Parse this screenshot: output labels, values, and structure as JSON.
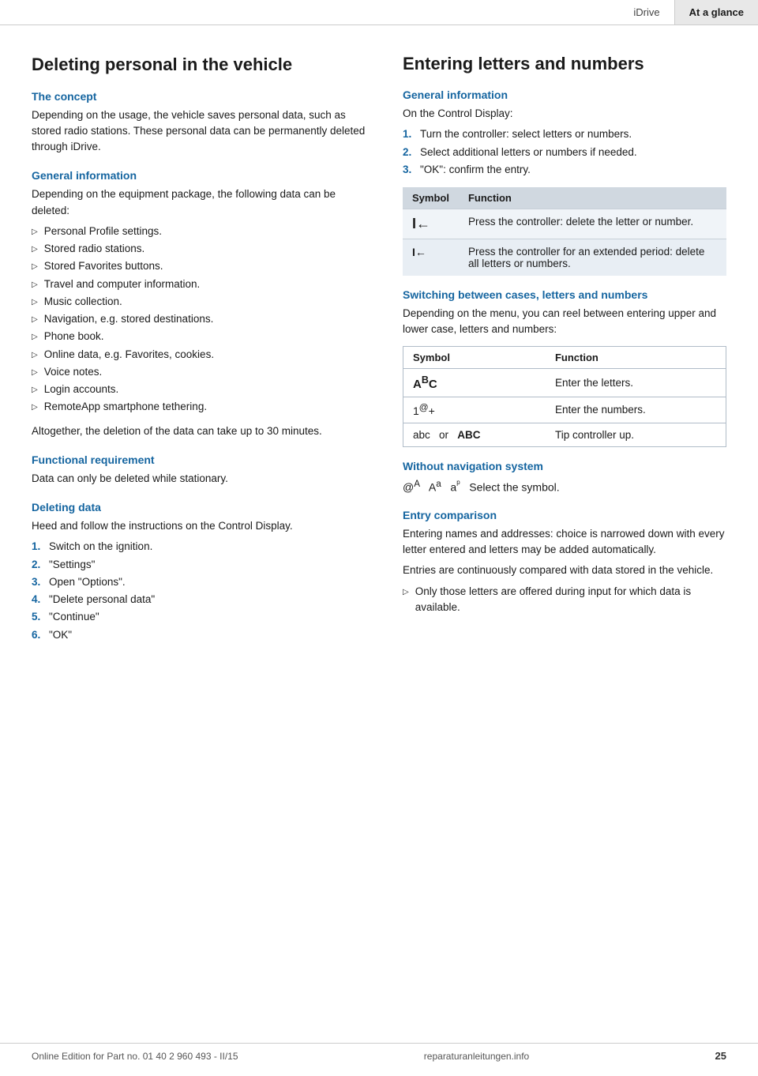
{
  "header": {
    "idrive_label": "iDrive",
    "ataglance_label": "At a glance"
  },
  "left": {
    "page_title": "Deleting personal in the vehicle",
    "sections": [
      {
        "id": "concept",
        "heading": "The concept",
        "paragraphs": [
          "Depending on the usage, the vehicle saves personal data, such as stored radio stations. These personal data can be permanently deleted through iDrive."
        ]
      },
      {
        "id": "general-info",
        "heading": "General information",
        "paragraphs": [
          "Depending on the equipment package, the following data can be deleted:"
        ],
        "bullets": [
          "Personal Profile settings.",
          "Stored radio stations.",
          "Stored Favorites buttons.",
          "Travel and computer information.",
          "Music collection.",
          "Navigation, e.g. stored destinations.",
          "Phone book.",
          "Online data, e.g. Favorites, cookies.",
          "Voice notes.",
          "Login accounts.",
          "RemoteApp smartphone tethering."
        ],
        "after_bullets": "Altogether, the deletion of the data can take up to 30 minutes."
      },
      {
        "id": "functional-req",
        "heading": "Functional requirement",
        "paragraphs": [
          "Data can only be deleted while stationary."
        ]
      },
      {
        "id": "deleting-data",
        "heading": "Deleting data",
        "paragraphs": [
          "Heed and follow the instructions on the Control Display."
        ],
        "steps": [
          "Switch on the ignition.",
          "\"Settings\"",
          "Open \"Options\".",
          "\"Delete personal data\"",
          "\"Continue\"",
          "\"OK\""
        ]
      }
    ]
  },
  "right": {
    "page_title": "Entering letters and numbers",
    "sections": [
      {
        "id": "general-info-right",
        "heading": "General information",
        "paragraphs": [
          "On the Control Display:"
        ],
        "steps": [
          "Turn the controller: select letters or numbers.",
          "Select additional letters or numbers if needed.",
          "\"OK\": confirm the entry."
        ],
        "table": {
          "headers": [
            "Symbol",
            "Function"
          ],
          "rows": [
            {
              "symbol": "I←",
              "function": "Press the controller: delete the letter or number."
            },
            {
              "symbol": "I←",
              "function": "Press the controller for an extended period: delete all letters or numbers."
            }
          ]
        }
      },
      {
        "id": "switching",
        "heading": "Switching between cases, letters and numbers",
        "paragraphs": [
          "Depending on the menu, you can reel between entering upper and lower case, letters and numbers:"
        ],
        "switch_table": {
          "headers": [
            "Symbol",
            "Function"
          ],
          "rows": [
            {
              "symbol": "AᴬC",
              "symbol_type": "abc",
              "function": "Enter the letters."
            },
            {
              "symbol": "1@+",
              "symbol_type": "num",
              "function": "Enter the numbers."
            },
            {
              "symbol": "abc  or  ABC",
              "symbol_type": "plain",
              "function": "Tip controller up."
            }
          ]
        }
      },
      {
        "id": "without-nav",
        "heading": "Without navigation system",
        "symbols_line": "@ᴬ  Aᵃ  aᵖ  Select the symbol.",
        "symbols_display": "ꜰA  Aᵃ  aᵖ  Select the symbol."
      },
      {
        "id": "entry-comparison",
        "heading": "Entry comparison",
        "paragraphs": [
          "Entering names and addresses: choice is narrowed down with every letter entered and letters may be added automatically.",
          "Entries are continuously compared with data stored in the vehicle."
        ],
        "bullets": [
          "Only those letters are offered during input for which data is available."
        ]
      }
    ]
  },
  "footer": {
    "online_edition": "Online Edition for Part no. 01 40 2 960 493 - II/15",
    "page_number": "25",
    "site": "reparaturanleitungen.info"
  }
}
